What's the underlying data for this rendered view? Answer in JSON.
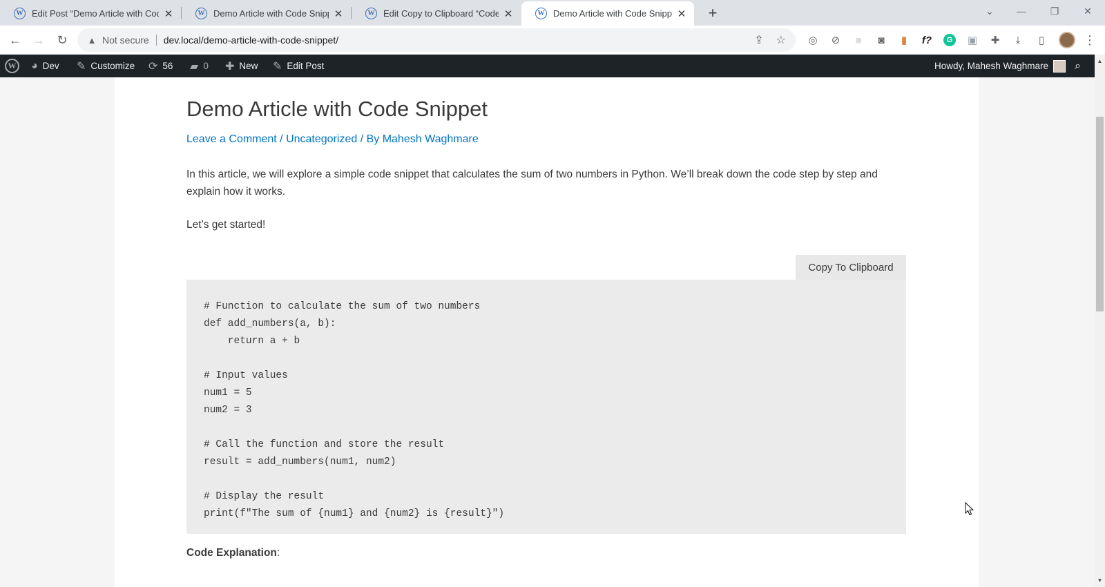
{
  "browser": {
    "tabs": [
      {
        "title": "Edit Post “Demo Article with Code",
        "active": false
      },
      {
        "title": "Demo Article with Code Snippet",
        "active": false
      },
      {
        "title": "Edit Copy to Clipboard “Code Sn",
        "active": false
      },
      {
        "title": "Demo Article with Code Snippet",
        "active": true
      }
    ],
    "security_label": "Not secure",
    "url": "dev.local/demo-article-with-code-snippet/",
    "extension_icons": [
      "compass-icon",
      "block-icon",
      "blank-extension-icon",
      "camera-icon",
      "bar-chart-icon",
      "function-icon",
      "grammarly-icon",
      "image-extension-icon",
      "puzzle-icon",
      "download-icon",
      "sidepanel-icon"
    ]
  },
  "adminbar": {
    "site_name": "Dev",
    "customize": "Customize",
    "updates_count": "56",
    "comments_count": "0",
    "new": "New",
    "edit_post": "Edit Post",
    "howdy": "Howdy, Mahesh Waghmare"
  },
  "article": {
    "title": "Demo Article with Code Snippet",
    "meta": {
      "comment_link": "Leave a Comment",
      "sep1": " / ",
      "category": "Uncategorized",
      "sep2": " / By ",
      "author": "Mahesh Waghmare"
    },
    "intro": "In this article, we will explore a simple code snippet that calculates the sum of two numbers in Python. We’ll break down the code step by step and explain how it works.",
    "lets_start": "Let’s get started!",
    "copy_button": "Copy To Clipboard",
    "code_lines": [
      "# Function to calculate the sum of two numbers",
      "def add_numbers(a, b):",
      "    return a + b",
      "",
      "# Input values",
      "num1 = 5",
      "num2 = 3",
      "",
      "# Call the function and store the result",
      "result = add_numbers(num1, num2)",
      "",
      "# Display the result",
      "print(f\"The sum of {num1} and {num2} is {result}\")"
    ],
    "explanation_heading": "Code Explanation",
    "explanation_colon": ":"
  },
  "colors": {
    "link": "#0274be",
    "adminbar_bg": "#1d2327",
    "code_bg": "#ebebeb",
    "text": "#3a3a3a"
  }
}
